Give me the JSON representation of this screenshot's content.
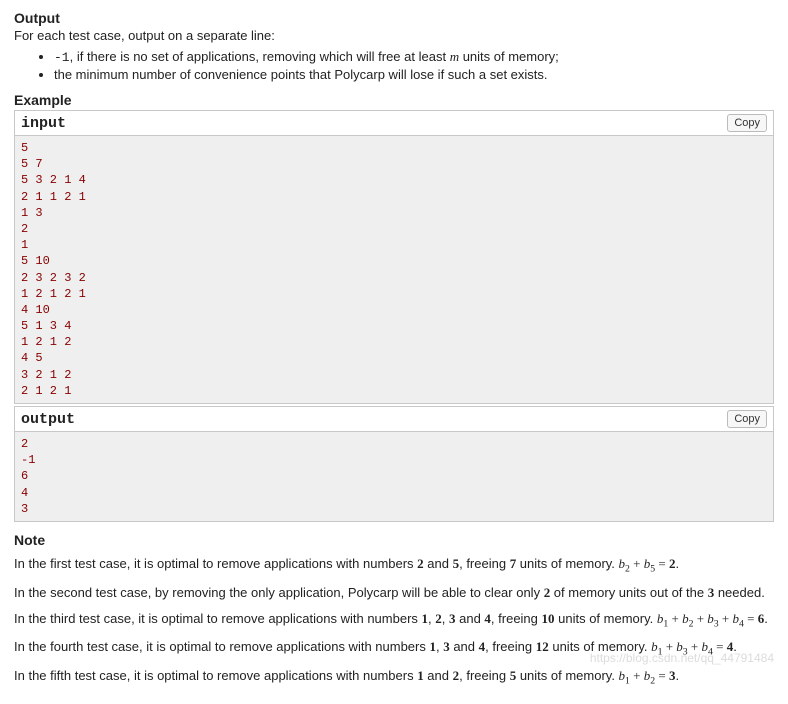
{
  "output_section": {
    "title": "Output",
    "intro": "For each test case, output on a separate line:",
    "bullets": [
      {
        "prefix_code": "-1",
        "text": ", if there is no set of applications, removing which will free at least ",
        "var1": "m",
        "suffix": " units of memory;"
      },
      {
        "text": "the minimum number of convenience points that Polycarp will lose if such a set exists."
      }
    ]
  },
  "example_section": {
    "title": "Example",
    "input_label": "input",
    "output_label": "output",
    "copy_label": "Copy",
    "input_text": "5\n5 7\n5 3 2 1 4\n2 1 1 2 1\n1 3\n2\n1\n5 10\n2 3 2 3 2\n1 2 1 2 1\n4 10\n5 1 3 4\n1 2 1 2\n4 5\n3 2 1 2\n2 1 2 1",
    "output_text": "2\n-1\n6\n4\n3"
  },
  "note_section": {
    "title": "Note",
    "p1": {
      "pre": "In the first test case, it is optimal to remove applications with numbers ",
      "b1": "2",
      "mid1": " and ",
      "b2": "5",
      "mid2": ", freeing ",
      "b3": "7",
      "post": " units of memory. ",
      "eq_lhs_a": "b",
      "eq_lhs_a_sub": "2",
      "eq_plus": " + ",
      "eq_lhs_b": "b",
      "eq_lhs_b_sub": "5",
      "eq_eq": " = ",
      "eq_rhs": "2",
      "dot": "."
    },
    "p2": {
      "pre": "In the second test case, by removing the only application, Polycarp will be able to clear only ",
      "b1": "2",
      "mid": " of memory units out of the ",
      "b2": "3",
      "post": " needed."
    },
    "p3": {
      "pre": "In the third test case, it is optimal to remove applications with numbers ",
      "b1": "1",
      "c1": ", ",
      "b2": "2",
      "c2": ", ",
      "b3": "3",
      "c3": " and ",
      "b4": "4",
      "mid": ", freeing ",
      "b5": "10",
      "post": " units of memory. ",
      "t1": "b",
      "s1": "1",
      "pl1": " + ",
      "t2": "b",
      "s2": "2",
      "pl2": " + ",
      "t3": "b",
      "s3": "3",
      "pl3": " + ",
      "t4": "b",
      "s4": "4",
      "eq": " = ",
      "rhs": "6",
      "dot": "."
    },
    "p4": {
      "pre": "In the fourth test case, it is optimal to remove applications with numbers ",
      "b1": "1",
      "c1": ", ",
      "b2": "3",
      "c2": " and ",
      "b3": "4",
      "mid": ", freeing ",
      "b4": "12",
      "post": " units of memory. ",
      "t1": "b",
      "s1": "1",
      "pl1": " + ",
      "t2": "b",
      "s2": "3",
      "pl2": " + ",
      "t3": "b",
      "s3": "4",
      "eq": " = ",
      "rhs": "4",
      "dot": "."
    },
    "p5": {
      "pre": "In the fifth test case, it is optimal to remove applications with numbers ",
      "b1": "1",
      "c1": " and ",
      "b2": "2",
      "mid": ", freeing ",
      "b3": "5",
      "post": " units of memory. ",
      "t1": "b",
      "s1": "1",
      "pl1": " + ",
      "t2": "b",
      "s2": "2",
      "eq": " = ",
      "rhs": "3",
      "dot": "."
    }
  },
  "watermark": "https://blog.csdn.net/qq_44791484"
}
